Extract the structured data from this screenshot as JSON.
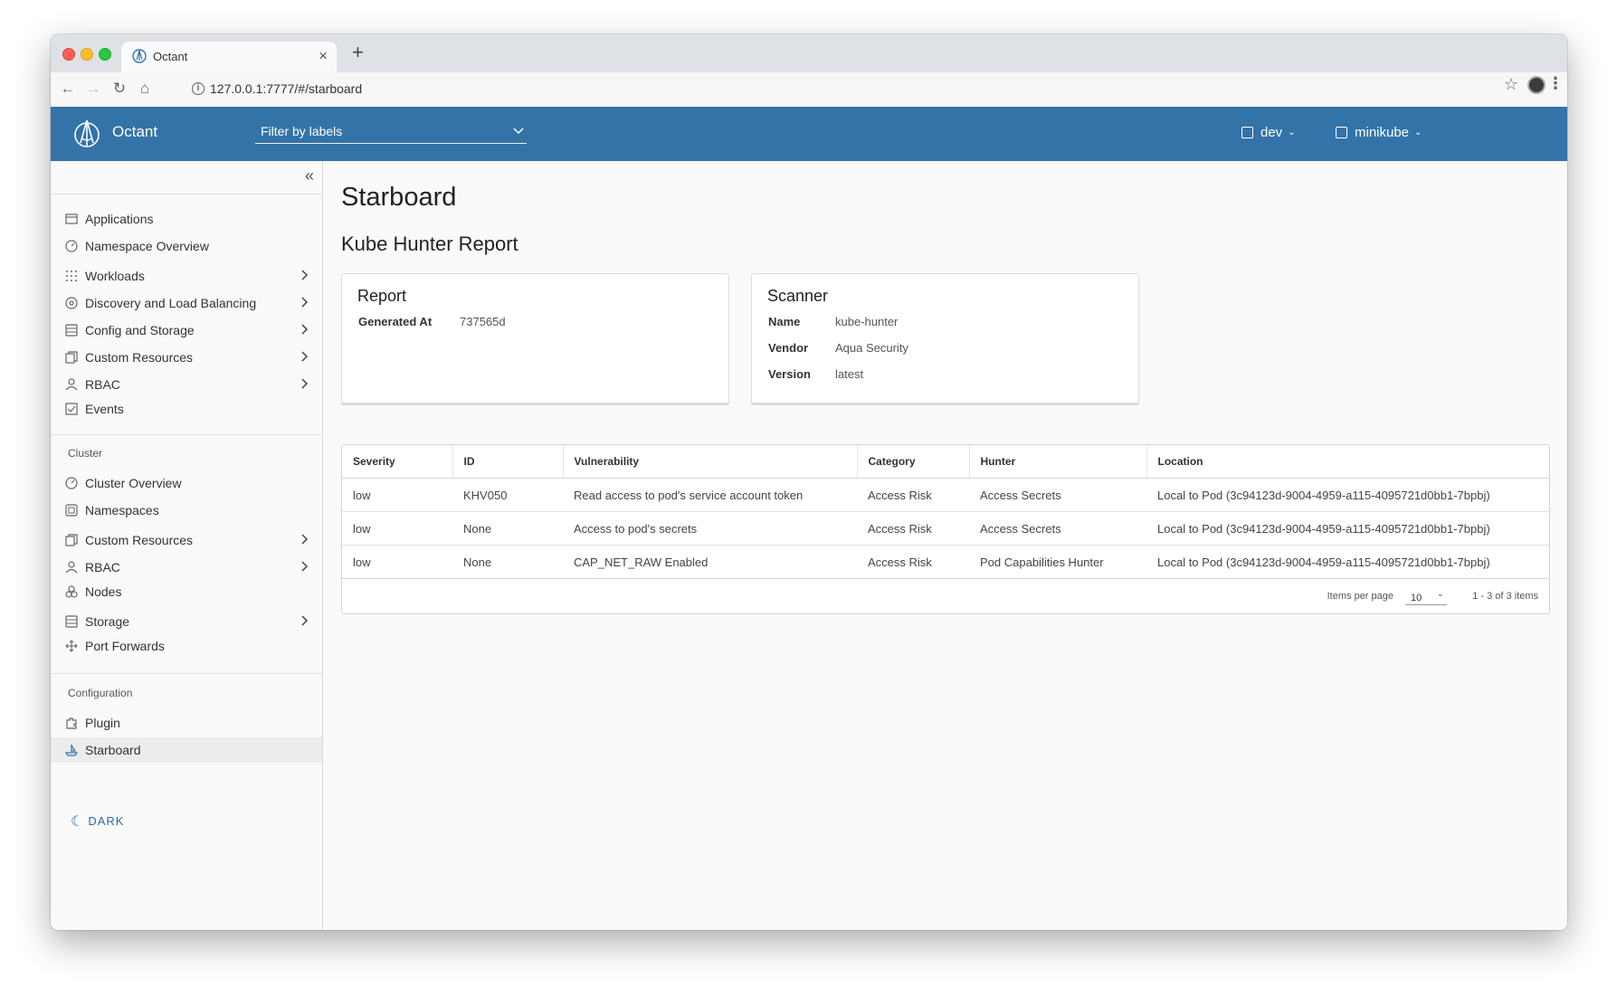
{
  "browser": {
    "tab_title": "Octant",
    "tab_close": "×",
    "new_tab": "+",
    "url": "127.0.0.1:7777/#/starboard"
  },
  "header": {
    "app_name": "Octant",
    "filter_placeholder": "Filter by labels",
    "namespace": "dev",
    "context": "minikube"
  },
  "sidebar": {
    "collapse_glyph": "«",
    "namespace_items": [
      {
        "label": "Applications",
        "icon": "window-icon"
      },
      {
        "label": "Namespace Overview",
        "icon": "dashboard-icon"
      },
      {
        "label": "Workloads",
        "icon": "grid-icon"
      },
      {
        "label": "Discovery and Load Balancing",
        "icon": "network-icon"
      },
      {
        "label": "Config and Storage",
        "icon": "storage-icon"
      },
      {
        "label": "Custom Resources",
        "icon": "copy-icon"
      },
      {
        "label": "RBAC",
        "icon": "user-icon"
      },
      {
        "label": "Events",
        "icon": "checkbox-icon"
      }
    ],
    "cluster_title": "Cluster",
    "cluster_items": [
      {
        "label": "Cluster Overview",
        "icon": "dashboard-icon"
      },
      {
        "label": "Namespaces",
        "icon": "namespace-icon"
      },
      {
        "label": "Custom Resources",
        "icon": "copy-icon"
      },
      {
        "label": "RBAC",
        "icon": "user-icon"
      },
      {
        "label": "Nodes",
        "icon": "nodes-icon"
      },
      {
        "label": "Storage",
        "icon": "storage-icon"
      },
      {
        "label": "Port Forwards",
        "icon": "move-icon"
      }
    ],
    "configuration_title": "Configuration",
    "configuration_items": [
      {
        "label": "Plugin",
        "icon": "plugin-icon"
      },
      {
        "label": "Starboard",
        "icon": "ship-icon"
      }
    ],
    "dark_label": "DARK"
  },
  "main": {
    "page_title": "Starboard",
    "section_title": "Kube Hunter Report",
    "report_card": {
      "title": "Report",
      "fields": [
        {
          "key": "Generated At",
          "value": "737565d"
        }
      ]
    },
    "scanner_card": {
      "title": "Scanner",
      "fields": [
        {
          "key": "Name",
          "value": "kube-hunter"
        },
        {
          "key": "Vendor",
          "value": "Aqua Security"
        },
        {
          "key": "Version",
          "value": "latest"
        }
      ]
    },
    "table": {
      "columns": [
        "Severity",
        "ID",
        "Vulnerability",
        "Category",
        "Hunter",
        "Location"
      ],
      "rows": [
        [
          "low",
          "KHV050",
          "Read access to pod's service account token",
          "Access Risk",
          "Access Secrets",
          "Local to Pod (3c94123d-9004-4959-a115-4095721d0bb1-7bpbj)"
        ],
        [
          "low",
          "None",
          "Access to pod's secrets",
          "Access Risk",
          "Access Secrets",
          "Local to Pod (3c94123d-9004-4959-a115-4095721d0bb1-7bpbj)"
        ],
        [
          "low",
          "None",
          "CAP_NET_RAW Enabled",
          "Access Risk",
          "Pod Capabilities Hunter",
          "Local to Pod (3c94123d-9004-4959-a115-4095721d0bb1-7bpbj)"
        ]
      ],
      "items_per_page_label": "Items per page",
      "items_per_page_value": "10",
      "page_count": "1 - 3 of 3 items"
    }
  },
  "colors": {
    "header_bg": "#3373a8",
    "link_blue": "#2c6ea6",
    "sidebar_active": "#ececec"
  }
}
